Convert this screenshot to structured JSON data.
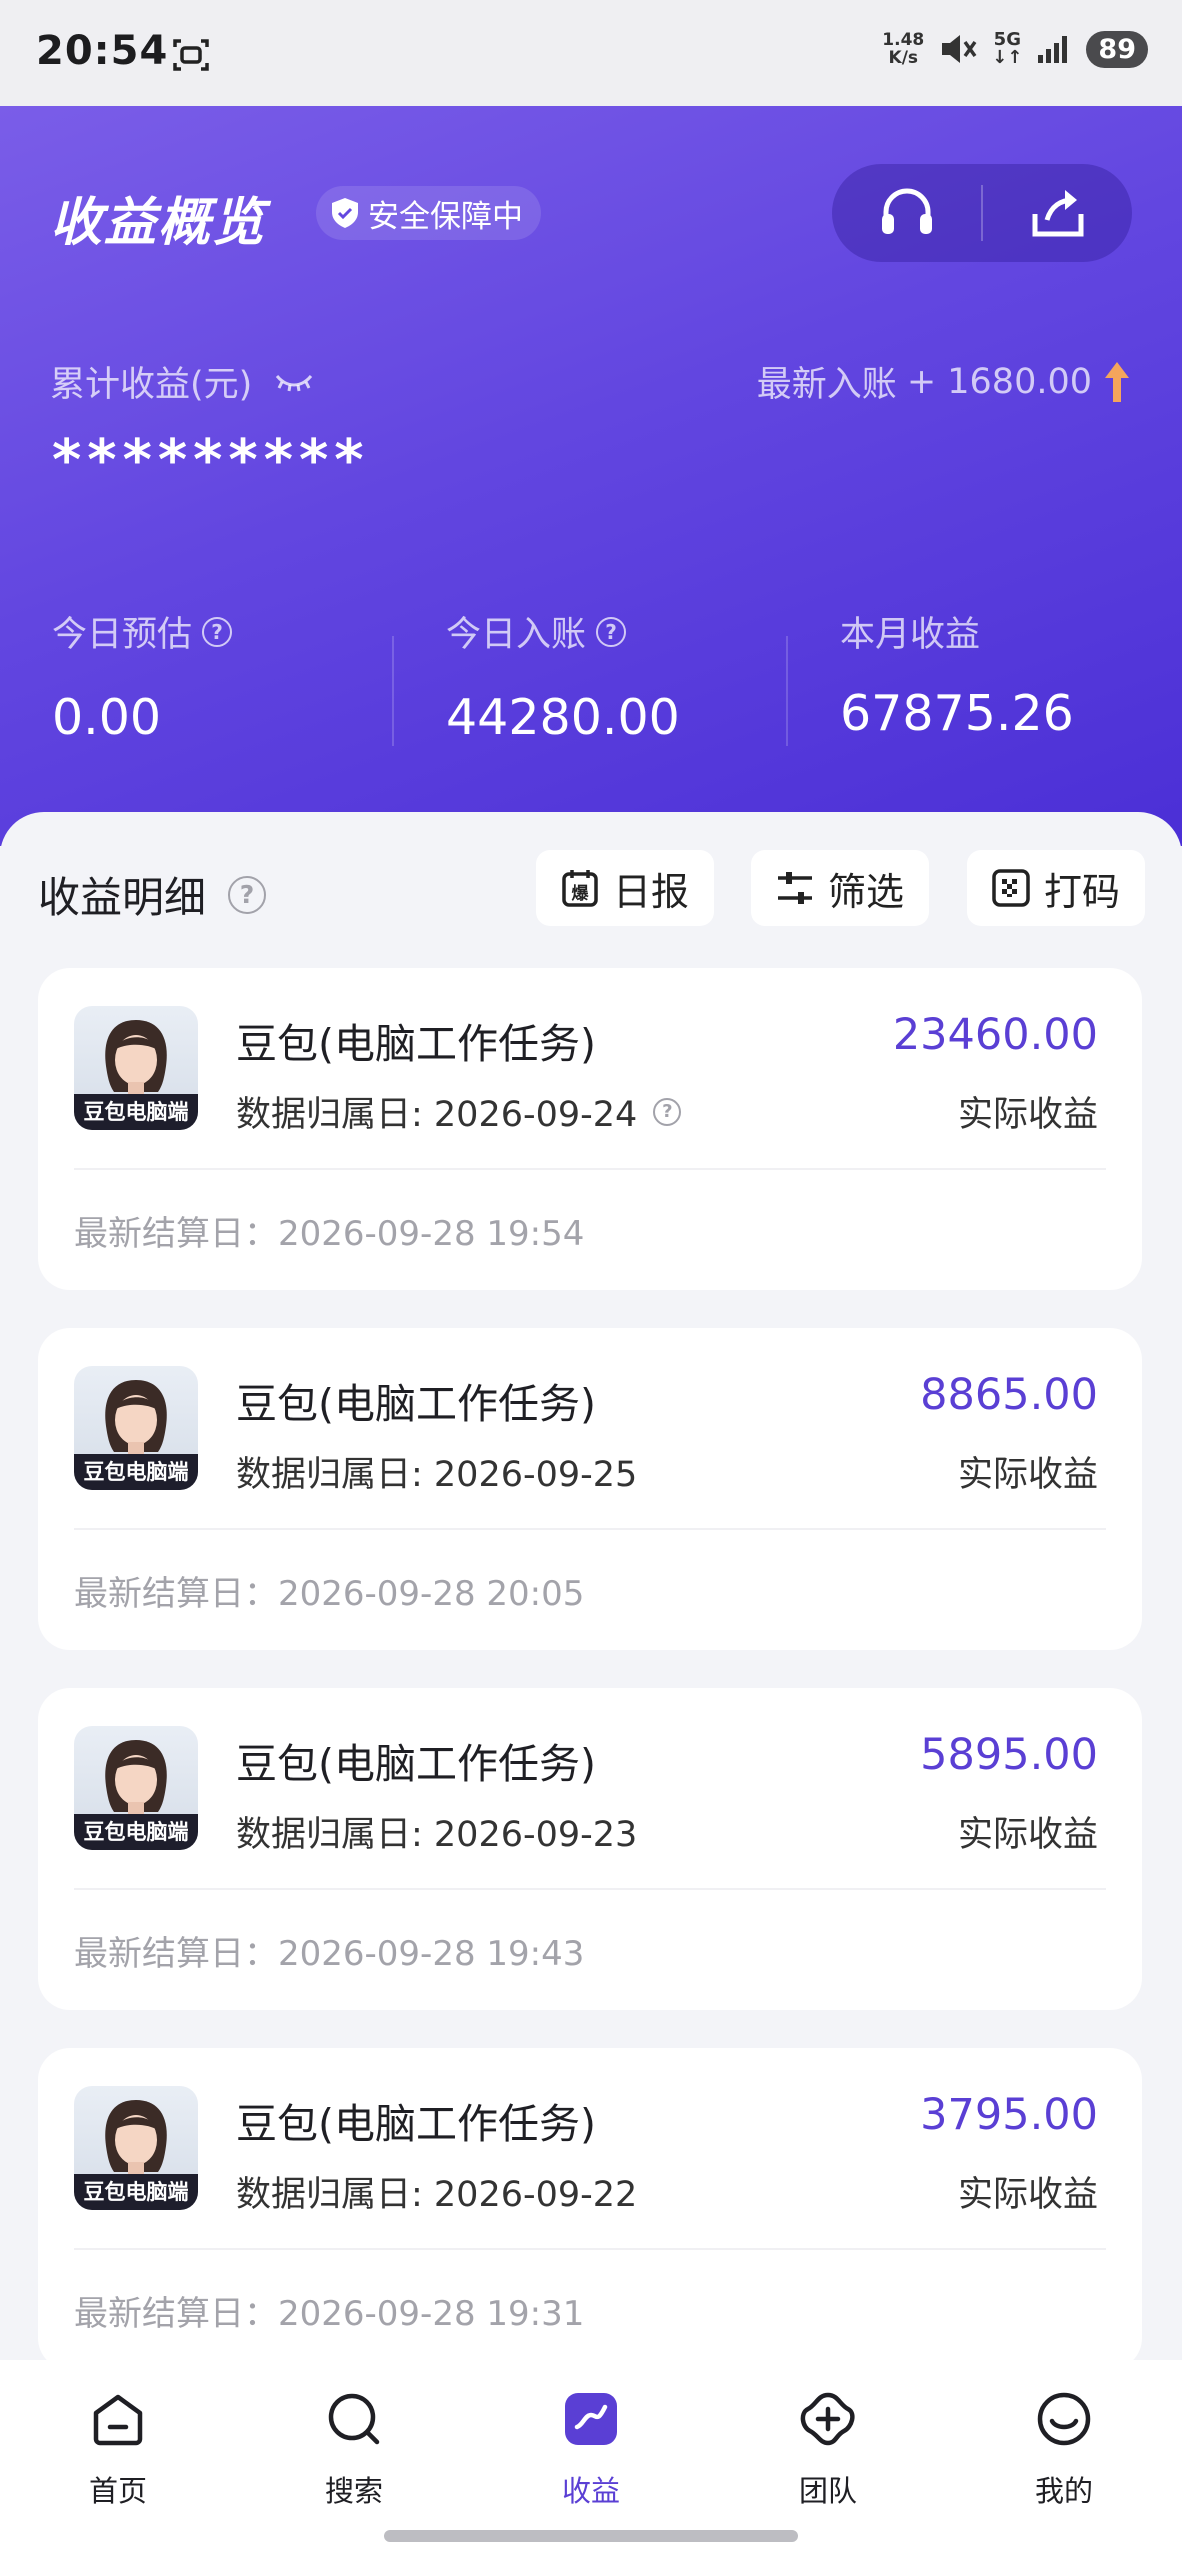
{
  "status_bar": {
    "time": "20:54",
    "speed_value": "1.48",
    "speed_unit": "K/s",
    "network": "5G",
    "battery": "89"
  },
  "header": {
    "title": "收益概览",
    "safe_badge": "安全保障中",
    "cumulative_label": "累计收益(元)",
    "latest_label": "最新入账",
    "latest_value": "+ 1680.00",
    "masked_total": "*********",
    "stats": [
      {
        "label": "今日预估",
        "value": "0.00"
      },
      {
        "label": "今日入账",
        "value": "44280.00"
      },
      {
        "label": "本月收益",
        "value": "67875.26"
      }
    ]
  },
  "detail": {
    "title": "收益明细",
    "buttons": {
      "daily": "日报",
      "filter": "筛选",
      "code": "打码"
    }
  },
  "records": [
    {
      "avatar_badge": "豆包电脑端",
      "name": "豆包(电脑工作任务)",
      "date": "数据归属日: 2026-09-24",
      "amount": "23460.00",
      "amount_label": "实际收益",
      "settle": "最新结算日：2026-09-28 19:54"
    },
    {
      "avatar_badge": "豆包电脑端",
      "name": "豆包(电脑工作任务)",
      "date": "数据归属日: 2026-09-25",
      "amount": "8865.00",
      "amount_label": "实际收益",
      "settle": "最新结算日：2026-09-28 20:05"
    },
    {
      "avatar_badge": "豆包电脑端",
      "name": "豆包(电脑工作任务)",
      "date": "数据归属日: 2026-09-23",
      "amount": "5895.00",
      "amount_label": "实际收益",
      "settle": "最新结算日：2026-09-28 19:43"
    },
    {
      "avatar_badge": "豆包电脑端",
      "name": "豆包(电脑工作任务)",
      "date": "数据归属日: 2026-09-22",
      "amount": "3795.00",
      "amount_label": "实际收益",
      "settle": "最新结算日：2026-09-28 19:31"
    }
  ],
  "nav": {
    "items": [
      {
        "label": "首页",
        "icon": "home-icon"
      },
      {
        "label": "搜索",
        "icon": "search-icon"
      },
      {
        "label": "收益",
        "icon": "earnings-icon"
      },
      {
        "label": "团队",
        "icon": "team-icon"
      },
      {
        "label": "我的",
        "icon": "profile-icon"
      }
    ],
    "active": "收益"
  },
  "colors": {
    "accent": "#5a3fd4",
    "header_start": "#7a5de8",
    "header_end": "#4b2fd6"
  }
}
